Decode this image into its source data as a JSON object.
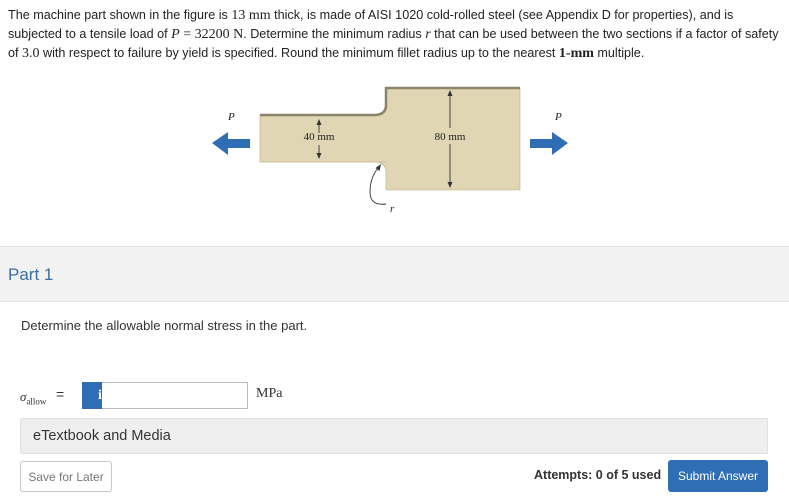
{
  "problem": {
    "t1": "The machine part shown in the figure is ",
    "thickness": "13 mm",
    "t2": " thick, is made of AISI 1020 cold-rolled steel (see Appendix D for properties), and is subjected to a tensile load of ",
    "load_symbol": "P",
    "load_eq": " = 32200 N",
    "t3": ". Determine the minimum radius ",
    "radius_symbol": "r",
    "t4": " that can be used between the two sections if a factor of safety of ",
    "fos": "3.0",
    "t5": " with respect to failure by yield is specified. Round the minimum fillet radius up to the nearest ",
    "round_unit": "1-mm",
    "t6": " multiple."
  },
  "figure": {
    "load_left": "P",
    "load_right": "P",
    "small_width": "40 mm",
    "large_width": "80 mm",
    "radius_label": "r",
    "part_color": "#e0d6b4"
  },
  "part": {
    "title": "Part 1"
  },
  "question": "Determine the allowable normal stress in the part.",
  "answer": {
    "symbol": "σ",
    "subscript": "allow",
    "equals": "=",
    "info_icon": "i",
    "value": "",
    "unit": "MPa"
  },
  "etextbook_label": "eTextbook and Media",
  "footer": {
    "save_label": "Save for Later",
    "attempts": "Attempts: 0 of 5 used",
    "submit_label": "Submit Answer"
  },
  "colors": {
    "accent": "#2f6db5",
    "part_title": "#3a6fa6",
    "band": "#f2f2f2"
  }
}
